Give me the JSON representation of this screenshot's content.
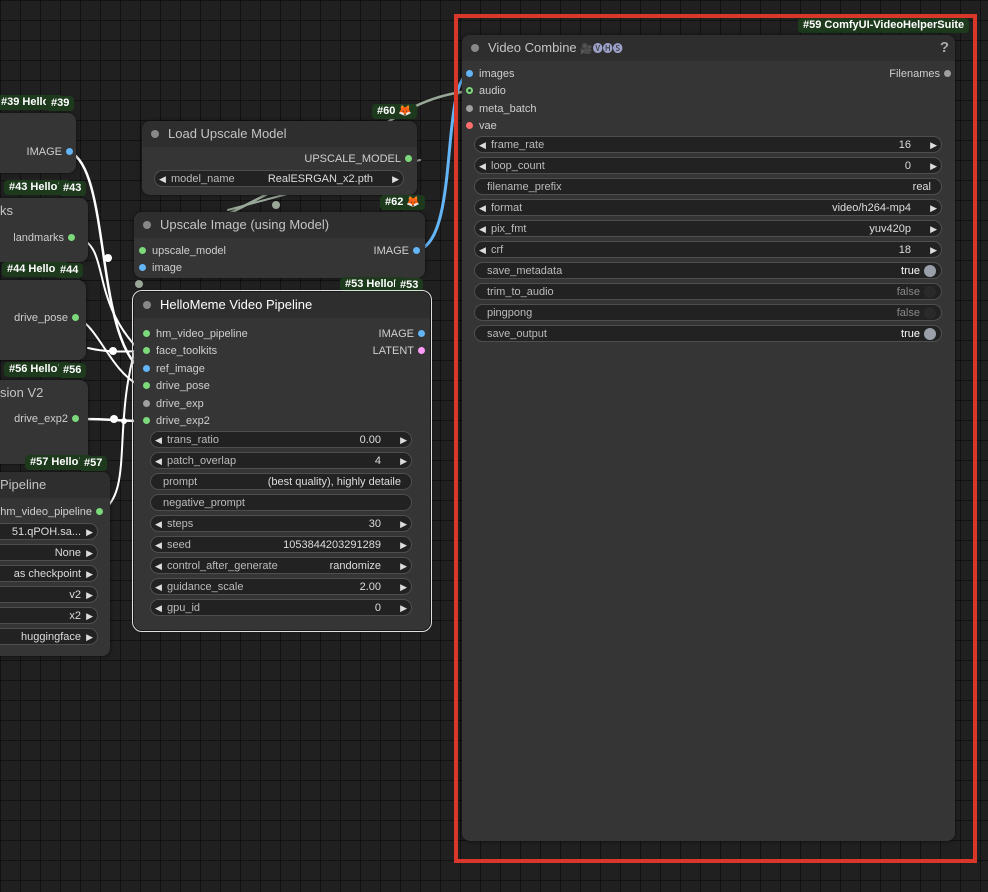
{
  "nodes": {
    "n39": {
      "badge": "#39 HelloM",
      "badge_id": "#39",
      "out_image": "IMAGE"
    },
    "n43": {
      "badge": "#43 HelloM",
      "badge_id": "#43",
      "title": "ks",
      "out_landmarks": "landmarks"
    },
    "n44": {
      "badge": "#44 HelloM",
      "badge_id": "#44",
      "out_drive_pose": "drive_pose"
    },
    "n56": {
      "badge": "#56 HelloM",
      "badge_id": "#56",
      "title": "sion V2",
      "out_drive_exp2": "drive_exp2"
    },
    "n57": {
      "badge": "#57 HelloM",
      "badge_id": "#57",
      "title": "Pipeline",
      "out_pipeline": "hm_video_pipeline",
      "widgets": [
        "51.qPOH.sa...",
        "None",
        "as checkpoint",
        "v2",
        "x2",
        "huggingface"
      ]
    },
    "n60": {
      "badge": "#60"
    },
    "n62": {
      "badge": "#62"
    },
    "load_upscale": {
      "title": "Load Upscale Model",
      "out_upscale_model": "UPSCALE_MODEL",
      "widget_label": "model_name",
      "widget_value": "RealESRGAN_x2.pth"
    },
    "upscale_image": {
      "title": "Upscale Image (using Model)",
      "in_upscale_model": "upscale_model",
      "in_image": "image",
      "out_image": "IMAGE"
    },
    "n53": {
      "badge": "#53 HelloM",
      "badge_id": "#53",
      "title": "HelloMeme Video Pipeline",
      "inputs": [
        "hm_video_pipeline",
        "face_toolkits",
        "ref_image",
        "drive_pose",
        "drive_exp",
        "drive_exp2"
      ],
      "out_image": "IMAGE",
      "out_latent": "LATENT",
      "widgets": [
        {
          "label": "trans_ratio",
          "value": "0.00"
        },
        {
          "label": "patch_overlap",
          "value": "4"
        },
        {
          "label": "prompt",
          "value": "(best quality), highly detaile"
        },
        {
          "label": "negative_prompt",
          "value": ""
        },
        {
          "label": "steps",
          "value": "30"
        },
        {
          "label": "seed",
          "value": "1053844203291289"
        },
        {
          "label": "control_after_generate",
          "value": "randomize"
        },
        {
          "label": "guidance_scale",
          "value": "2.00"
        },
        {
          "label": "gpu_id",
          "value": "0"
        }
      ]
    },
    "n59": {
      "badge": "#59 ComfyUI-VideoHelperSuite",
      "title": "Video Combine",
      "title_suffix": "🎥🅥🅗🅢",
      "help": "?",
      "inputs": [
        "images",
        "audio",
        "meta_batch",
        "vae"
      ],
      "out_filenames": "Filenames",
      "widgets": [
        {
          "label": "frame_rate",
          "value": "16"
        },
        {
          "label": "loop_count",
          "value": "0"
        },
        {
          "label": "filename_prefix",
          "value": "real"
        },
        {
          "label": "format",
          "value": "video/h264-mp4"
        },
        {
          "label": "pix_fmt",
          "value": "yuv420p"
        },
        {
          "label": "crf",
          "value": "18"
        },
        {
          "label": "save_metadata",
          "value": "true"
        },
        {
          "label": "trim_to_audio",
          "value": "false"
        },
        {
          "label": "pingpong",
          "value": "false"
        },
        {
          "label": "save_output",
          "value": "true"
        }
      ]
    }
  },
  "icons": {
    "fox": "🦊",
    "arrow_left": "◀",
    "arrow_right": "▶"
  },
  "colors": {
    "pin_image": "#64b5f6",
    "pin_green": "#7bd97b",
    "pin_latent": "#ff9cf9",
    "pin_vae": "#ff6e6e",
    "pin_gray": "#a0a0a0",
    "highlight_frame": "#d9372a"
  }
}
